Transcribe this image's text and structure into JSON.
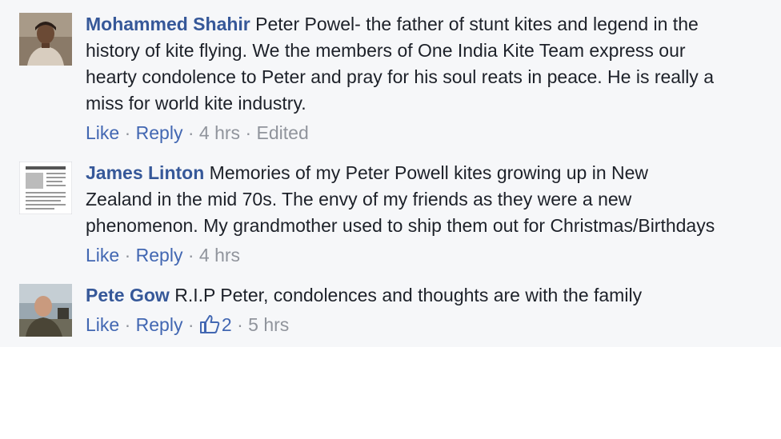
{
  "comments": [
    {
      "author": "Mohammed Shahir",
      "lines": [
        "Peter Powel- the father of stunt kites and legend in the",
        "history of kite flying. We the members of One India Kite Team express our",
        "hearty condolence to Peter and pray for his soul reats in peace. He is really a",
        "miss for world kite industry."
      ],
      "like_label": "Like",
      "reply_label": "Reply",
      "time": "4 hrs",
      "edited": "Edited",
      "avatar_icon": "person-photo-icon"
    },
    {
      "author": "James Linton",
      "lines": [
        "Memories of my Peter Powell kites growing up in New",
        "Zealand in the mid 70s. The envy of my friends as they were a new",
        "phenomenon. My grandmother used to ship them out for Christmas/Birthdays"
      ],
      "like_label": "Like",
      "reply_label": "Reply",
      "time": "4 hrs",
      "avatar_icon": "document-thumbnail-icon"
    },
    {
      "author": "Pete Gow",
      "lines": [
        "R.I.P Peter, condolences and thoughts are with the family"
      ],
      "like_label": "Like",
      "reply_label": "Reply",
      "likes": "2",
      "time": "5 hrs",
      "avatar_icon": "person-photo-icon"
    }
  ],
  "separator": " · ",
  "colors": {
    "panel_bg": "#f6f7f9",
    "author": "#365899",
    "text": "#1d2129",
    "link": "#4267b2",
    "meta": "#90949c"
  }
}
